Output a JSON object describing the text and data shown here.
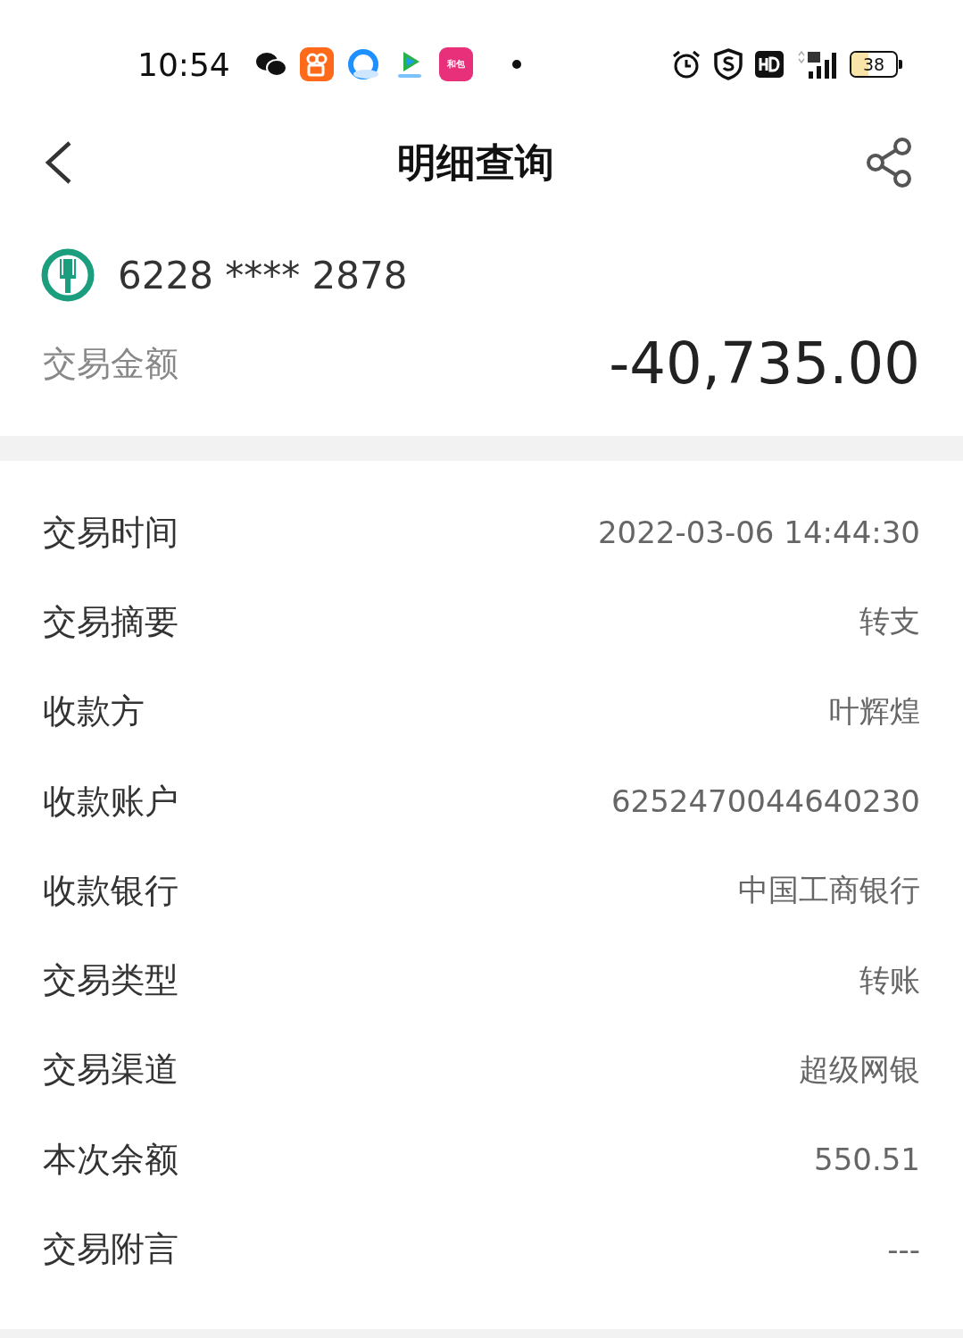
{
  "status_bar": {
    "time": "10:54",
    "app_icon_label": "和包",
    "battery": "38"
  },
  "header": {
    "title": "明细查询"
  },
  "account": {
    "number": "6228 **** 2878"
  },
  "amount": {
    "label": "交易金额",
    "value": "-40,735.00"
  },
  "details": [
    {
      "label": "交易时间",
      "value": "2022-03-06 14:44:30"
    },
    {
      "label": "交易摘要",
      "value": "转支"
    },
    {
      "label": "收款方",
      "value": "叶辉煌"
    },
    {
      "label": "收款账户",
      "value": "6252470044640230"
    },
    {
      "label": "收款银行",
      "value": "中国工商银行"
    },
    {
      "label": "交易类型",
      "value": "转账"
    },
    {
      "label": "交易渠道",
      "value": "超级网银"
    },
    {
      "label": "本次余额",
      "value": "550.51"
    },
    {
      "label": "交易附言",
      "value": "---"
    }
  ]
}
